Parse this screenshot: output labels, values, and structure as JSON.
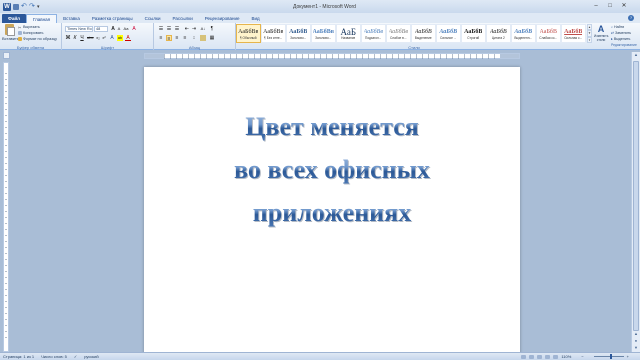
{
  "window": {
    "title": "Документ1 - Microsoft Word",
    "minimize": "–",
    "maximize": "□",
    "close": "✕"
  },
  "qat": {
    "word_icon": "W"
  },
  "tabs": [
    {
      "label": "Файл"
    },
    {
      "label": "Главная"
    },
    {
      "label": "Вставка"
    },
    {
      "label": "Разметка страницы"
    },
    {
      "label": "Ссылки"
    },
    {
      "label": "Рассылки"
    },
    {
      "label": "Рецензирование"
    },
    {
      "label": "Вид"
    }
  ],
  "ribbon": {
    "clipboard": {
      "paste": "Вставить",
      "cut": "Вырезать",
      "copy": "Копировать",
      "format_painter": "Формат по образцу",
      "label": "Буфер обмена"
    },
    "font": {
      "name": "Times New Ro",
      "size": "48",
      "label": "Шрифт"
    },
    "paragraph": {
      "label": "Абзац"
    },
    "styles": {
      "label": "Стили",
      "items": [
        {
          "preview": "АаБбВв",
          "name": "¶ Обычный"
        },
        {
          "preview": "АаБбВв",
          "name": "¶ Без инте..."
        },
        {
          "preview": "АаБбВ",
          "name": "Заголово..."
        },
        {
          "preview": "АаБбВв",
          "name": "Заголово..."
        },
        {
          "preview": "АаБ",
          "name": "Название"
        },
        {
          "preview": "АаБбВв",
          "name": "Подзагол..."
        },
        {
          "preview": "АаБбВв",
          "name": "Слабое в..."
        },
        {
          "preview": "АаБбВ",
          "name": "Выделение"
        },
        {
          "preview": "АаБбВ",
          "name": "Сильное ..."
        },
        {
          "preview": "АаБбВ",
          "name": "Строгий"
        },
        {
          "preview": "АаБбВ",
          "name": "Цитата 2"
        },
        {
          "preview": "АаБбВ",
          "name": "Выделенн..."
        },
        {
          "preview": "АаБбВ",
          "name": "Слабая сс..."
        },
        {
          "preview": "АаБбВ",
          "name": "Сильная с..."
        }
      ]
    },
    "change_styles": "Изменить стили",
    "editing": {
      "find": "Найти",
      "replace": "Заменить",
      "select": "Выделить",
      "label": "Редактирование"
    }
  },
  "document": {
    "lines": [
      "Цвет меняется",
      "во всех офисных",
      "приложениях"
    ]
  },
  "statusbar": {
    "page": "Страница: 1 из 1",
    "words": "Число слов: 5",
    "language": "русский",
    "zoom": "110%"
  }
}
